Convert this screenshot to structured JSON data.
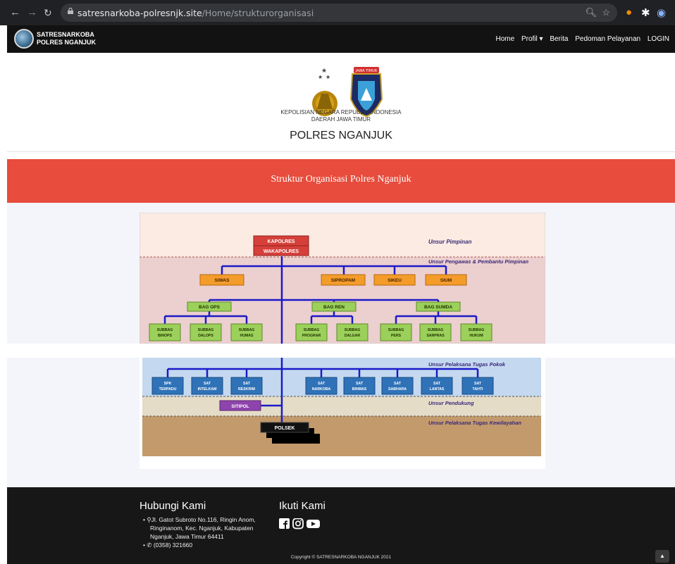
{
  "browser": {
    "domain": "satresnarkoba-polresnjk.site",
    "path": "/Home/strukturorganisasi"
  },
  "navbar": {
    "brand_line1": "SATRESNARKOBA",
    "brand_line2": "POLRES NGANJUK",
    "menu": [
      "Home",
      "Profil ▾",
      "Berita",
      "Pedoman Pelayanan",
      "LOGIN"
    ]
  },
  "header": {
    "badge": "JAWA TIMUR",
    "org_line1": "KEPOLISIAN NEGARA REPUBLIK INDONESIA",
    "org_line2": "DAERAH JAWA TIMUR",
    "title": "POLRES NGANJUK"
  },
  "banner": {
    "title": "Struktur Organisasi Polres Nganjuk"
  },
  "orgchart": {
    "bands": [
      "Unsur Pimpinan",
      "Unsur Pengawas & Pembantu Pimpinan",
      "Unsur Pelaksana Tugas Pokok",
      "Unsur Pendukung",
      "Unsur Pelaksana Tugas Kewilayahan"
    ],
    "leaders": [
      "KAPOLRES",
      "WAKAPOLRES"
    ],
    "supervisors": [
      "SIWAS",
      "SIPROPAM",
      "SIKEU",
      "SIUM"
    ],
    "bags": [
      "BAG OPS",
      "BAG REN",
      "BAG SUMDA"
    ],
    "subbags": [
      [
        "SUBBAG",
        "BINOPS"
      ],
      [
        "SUBBAG",
        "DALOPS"
      ],
      [
        "SUBBAG",
        "HUMAS"
      ],
      [
        "SUBBAG",
        "PROGRAR"
      ],
      [
        "SUBBAG",
        "DALGAR"
      ],
      [
        "SUBBAG",
        "PERS"
      ],
      [
        "SUBBAG",
        "SARPRAS"
      ],
      [
        "SUBBAG",
        "HUKUM"
      ]
    ],
    "sats": [
      [
        "SPK",
        "TERPADU"
      ],
      [
        "SAT",
        "INTELKAM"
      ],
      [
        "SAT",
        "RESKRIM"
      ],
      [
        "SAT",
        "NARKOBA"
      ],
      [
        "SAT",
        "BINMAS"
      ],
      [
        "SAT",
        "SABHARA"
      ],
      [
        "SAT",
        "LANTAS"
      ],
      [
        "SAT",
        "TAHTI"
      ]
    ],
    "support": "SITIPOL",
    "territorial": "POLSEK"
  },
  "footer": {
    "contact_heading": "Hubungi Kami",
    "address": "Jl. Gatot Subroto No.116, Ringin Anom, Ringinanom, Kec. Nganjuk, Kabupaten Nganjuk, Jawa Timur 64411",
    "phone": "(0358) 321660",
    "social_heading": "Ikuti Kami",
    "copyright": "Copyright © SATRESNARKOBA NGANJUK 2021"
  }
}
